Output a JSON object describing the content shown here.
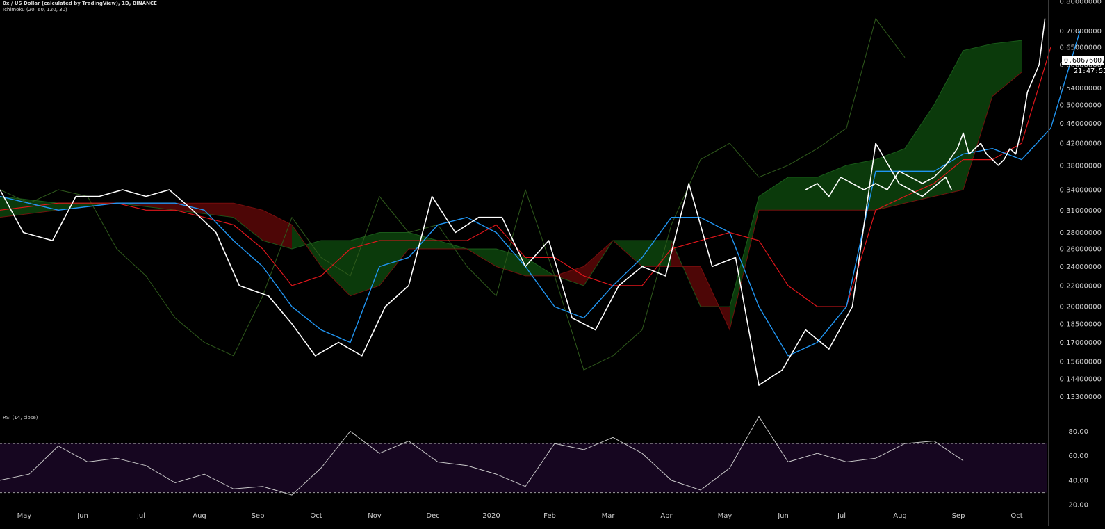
{
  "header": {
    "symbol_title": "0x / US Dollar (calculated by TradingView), 1D, BINANCE",
    "ichimoku_label": "Ichimoku (20, 60, 120, 30)",
    "rsi_label": "RSI (14, close)"
  },
  "price_scale": {
    "last_price": "0.60676007",
    "countdown": "21:47:55"
  },
  "colors": {
    "background": "#000000",
    "price": "#ffffff",
    "tenkan": "#2196f3",
    "kijun": "#e0161b",
    "lagging": "#2f5a1c",
    "cloud_bull": "#0b3a0b",
    "cloud_bear": "#4d0606",
    "rsi_band": "#160620",
    "rsi_line": "#c8c8c8",
    "axis_text": "#d0d0d0",
    "grid_dash": "#9a9a9a"
  },
  "chart_data": [
    {
      "type": "line",
      "panel": "price",
      "y_scale": "log",
      "ylim": [
        0.125,
        0.8
      ],
      "ytick_labels": [
        "0.80000000",
        "0.70000000",
        "0.65000000",
        "0.60000000",
        "0.54000000",
        "0.50000000",
        "0.46000000",
        "0.42000000",
        "0.38000000",
        "0.34000000",
        "0.31000000",
        "0.28000000",
        "0.26000000",
        "0.24000000",
        "0.22000000",
        "0.20000000",
        "0.18500000",
        "0.17000000",
        "0.15600000",
        "0.14400000",
        "0.13300000"
      ],
      "ytick_values": [
        0.8,
        0.7,
        0.65,
        0.6,
        0.54,
        0.5,
        0.46,
        0.42,
        0.38,
        0.34,
        0.31,
        0.28,
        0.26,
        0.24,
        0.22,
        0.2,
        0.185,
        0.17,
        0.156,
        0.144,
        0.133
      ],
      "x_months": [
        "May",
        "Jun",
        "Jul",
        "Aug",
        "Sep",
        "Oct",
        "Nov",
        "Dec",
        "2020",
        "Feb",
        "Mar",
        "Apr",
        "May",
        "Jun",
        "Jul",
        "Aug",
        "Sep",
        "Oct"
      ],
      "series": [
        {
          "key": "price",
          "x": [
            0,
            0.4,
            0.9,
            1.3,
            1.7,
            2.1,
            2.5,
            2.9,
            3.3,
            3.7,
            4.1,
            4.6,
            5.0,
            5.4,
            5.8,
            6.2,
            6.6,
            7.0,
            7.4,
            7.8,
            8.2,
            8.6,
            9.0,
            9.4,
            9.8,
            10.2,
            10.6,
            11.0,
            11.4,
            11.8,
            12.2,
            12.6,
            13.0,
            13.4,
            13.8,
            14.2,
            14.6,
            15.0,
            15.4,
            15.8,
            16.2,
            16.3
          ],
          "y": [
            0.34,
            0.28,
            0.27,
            0.33,
            0.33,
            0.34,
            0.33,
            0.34,
            0.31,
            0.28,
            0.22,
            0.21,
            0.185,
            0.16,
            0.17,
            0.16,
            0.2,
            0.22,
            0.33,
            0.28,
            0.3,
            0.3,
            0.24,
            0.27,
            0.19,
            0.18,
            0.22,
            0.24,
            0.23,
            0.35,
            0.24,
            0.25,
            0.14,
            0.15,
            0.18,
            0.165,
            0.2,
            0.42,
            0.35,
            0.33,
            0.36,
            0.34
          ]
        },
        {
          "key": "price_late",
          "x": [
            13.8,
            14.0,
            14.2,
            14.4,
            14.6,
            14.8,
            15.0,
            15.2,
            15.4,
            15.6,
            15.8,
            16.0,
            16.2,
            16.4,
            16.5,
            16.6,
            16.8,
            16.9,
            17.0,
            17.1,
            17.2,
            17.3,
            17.4,
            17.5,
            17.6,
            17.8,
            17.9
          ],
          "y": [
            0.34,
            0.35,
            0.33,
            0.36,
            0.35,
            0.34,
            0.35,
            0.34,
            0.37,
            0.36,
            0.35,
            0.36,
            0.38,
            0.41,
            0.44,
            0.4,
            0.42,
            0.4,
            0.39,
            0.38,
            0.39,
            0.41,
            0.4,
            0.45,
            0.53,
            0.6,
            0.74
          ]
        },
        {
          "key": "tenkan",
          "x": [
            0,
            1,
            2,
            2.5,
            3,
            3.5,
            4,
            4.5,
            5,
            5.5,
            6,
            6.5,
            7,
            7.5,
            8,
            8.5,
            9,
            9.5,
            10,
            10.5,
            11,
            11.5,
            12,
            12.5,
            13,
            13.5,
            14,
            14.5,
            15,
            15.5,
            16,
            16.5,
            17,
            17.5,
            18,
            18.5
          ],
          "y": [
            0.33,
            0.31,
            0.32,
            0.32,
            0.32,
            0.31,
            0.27,
            0.24,
            0.2,
            0.18,
            0.17,
            0.24,
            0.25,
            0.29,
            0.3,
            0.28,
            0.24,
            0.2,
            0.19,
            0.22,
            0.25,
            0.3,
            0.3,
            0.28,
            0.2,
            0.16,
            0.17,
            0.2,
            0.37,
            0.37,
            0.37,
            0.4,
            0.41,
            0.39,
            0.45,
            0.7
          ]
        },
        {
          "key": "kijun",
          "x": [
            0,
            1,
            2,
            2.5,
            3,
            3.5,
            4,
            4.5,
            5,
            5.5,
            6,
            6.5,
            7,
            7.5,
            8,
            8.5,
            9,
            9.5,
            10,
            10.5,
            11,
            11.5,
            12,
            12.5,
            13,
            13.5,
            14,
            14.5,
            15,
            15.5,
            16,
            16.5,
            17,
            17.5,
            18
          ],
          "y": [
            0.31,
            0.32,
            0.32,
            0.31,
            0.31,
            0.3,
            0.29,
            0.26,
            0.22,
            0.23,
            0.26,
            0.27,
            0.27,
            0.27,
            0.27,
            0.29,
            0.25,
            0.25,
            0.23,
            0.22,
            0.22,
            0.26,
            0.27,
            0.28,
            0.27,
            0.22,
            0.2,
            0.2,
            0.31,
            0.33,
            0.35,
            0.39,
            0.39,
            0.42,
            0.65
          ]
        },
        {
          "key": "lagging",
          "x": [
            0,
            0.5,
            1,
            1.5,
            2,
            2.5,
            3,
            3.5,
            4,
            4.5,
            5,
            5.5,
            6,
            6.5,
            7,
            7.5,
            8,
            8.5,
            9,
            9.5,
            10,
            10.5,
            11,
            11.5,
            12,
            12.5,
            13,
            13.5,
            14,
            14.5,
            15,
            15.5
          ],
          "y": [
            0.34,
            0.32,
            0.34,
            0.33,
            0.26,
            0.23,
            0.19,
            0.17,
            0.16,
            0.21,
            0.3,
            0.25,
            0.23,
            0.33,
            0.28,
            0.29,
            0.24,
            0.21,
            0.34,
            0.23,
            0.15,
            0.16,
            0.18,
            0.29,
            0.39,
            0.42,
            0.36,
            0.38,
            0.41,
            0.45,
            0.74,
            0.62
          ]
        }
      ],
      "cloud": {
        "x": [
          0,
          1,
          2,
          3,
          4,
          4.5,
          5,
          5.5,
          6,
          6.5,
          7,
          7.5,
          8,
          8.5,
          9,
          9.5,
          10,
          10.5,
          11,
          11.5,
          12,
          12.5,
          13,
          13.5,
          14,
          14.5,
          15,
          15.5,
          16,
          16.5,
          17,
          17.5
        ],
        "span_a": [
          0.33,
          0.32,
          0.32,
          0.31,
          0.3,
          0.27,
          0.26,
          0.27,
          0.27,
          0.28,
          0.28,
          0.27,
          0.26,
          0.26,
          0.25,
          0.23,
          0.22,
          0.27,
          0.27,
          0.27,
          0.2,
          0.2,
          0.33,
          0.36,
          0.36,
          0.38,
          0.39,
          0.41,
          0.5,
          0.64,
          0.66,
          0.67
        ],
        "span_b": [
          0.3,
          0.31,
          0.32,
          0.32,
          0.32,
          0.31,
          0.29,
          0.24,
          0.21,
          0.22,
          0.26,
          0.26,
          0.26,
          0.24,
          0.23,
          0.23,
          0.24,
          0.27,
          0.24,
          0.24,
          0.24,
          0.18,
          0.31,
          0.31,
          0.31,
          0.31,
          0.31,
          0.32,
          0.33,
          0.34,
          0.52,
          0.58
        ]
      }
    },
    {
      "type": "line",
      "panel": "rsi",
      "ylim": [
        15,
        95
      ],
      "ytick_labels": [
        "80.00",
        "60.00",
        "40.00",
        "20.00"
      ],
      "ytick_values": [
        80,
        60,
        40,
        20
      ],
      "bands": [
        30,
        70
      ],
      "series": [
        {
          "key": "rsi",
          "x": [
            0,
            0.5,
            1,
            1.5,
            2,
            2.5,
            3,
            3.5,
            4,
            4.5,
            5,
            5.5,
            6,
            6.5,
            7,
            7.5,
            8,
            8.5,
            9,
            9.5,
            10,
            10.5,
            11,
            11.5,
            12,
            12.5,
            13,
            13.5,
            14,
            14.5,
            15,
            15.5,
            16,
            16.5
          ],
          "y": [
            40,
            45,
            68,
            55,
            58,
            52,
            38,
            45,
            33,
            35,
            28,
            50,
            80,
            62,
            72,
            55,
            52,
            45,
            35,
            70,
            65,
            75,
            62,
            40,
            32,
            50,
            92,
            55,
            62,
            55,
            58,
            70,
            72,
            56
          ]
        }
      ]
    }
  ]
}
